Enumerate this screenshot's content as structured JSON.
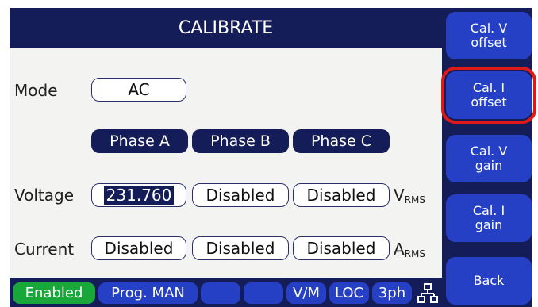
{
  "title": "CALIBRATE",
  "mode": {
    "label": "Mode",
    "value": "AC"
  },
  "phases": [
    "Phase A",
    "Phase B",
    "Phase C"
  ],
  "voltage": {
    "label": "Voltage",
    "values": [
      "231.760",
      "Disabled",
      "Disabled"
    ],
    "unit_main": "V",
    "unit_sub": "RMS"
  },
  "current": {
    "label": "Current",
    "values": [
      "Disabled",
      "Disabled",
      "Disabled"
    ],
    "unit_main": "A",
    "unit_sub": "RMS"
  },
  "side_buttons": [
    {
      "label_line1": "Cal. V",
      "label_line2": "offset"
    },
    {
      "label_line1": "Cal. I",
      "label_line2": "offset"
    },
    {
      "label_line1": "Cal. V",
      "label_line2": "gain"
    },
    {
      "label_line1": "Cal. I",
      "label_line2": "gain"
    },
    {
      "label_line1": "Back",
      "label_line2": ""
    }
  ],
  "status": {
    "enabled": "Enabled",
    "prog": "Prog. MAN",
    "blank1": "",
    "blank2": "",
    "vm": "V/M",
    "loc": "LOC",
    "phase3": "3ph",
    "network_icon": "network-icon"
  },
  "colors": {
    "header_bg": "#141d58",
    "button_blue": "#2540c4",
    "enabled_green": "#18a83a",
    "selected_outline": "#e01818"
  }
}
